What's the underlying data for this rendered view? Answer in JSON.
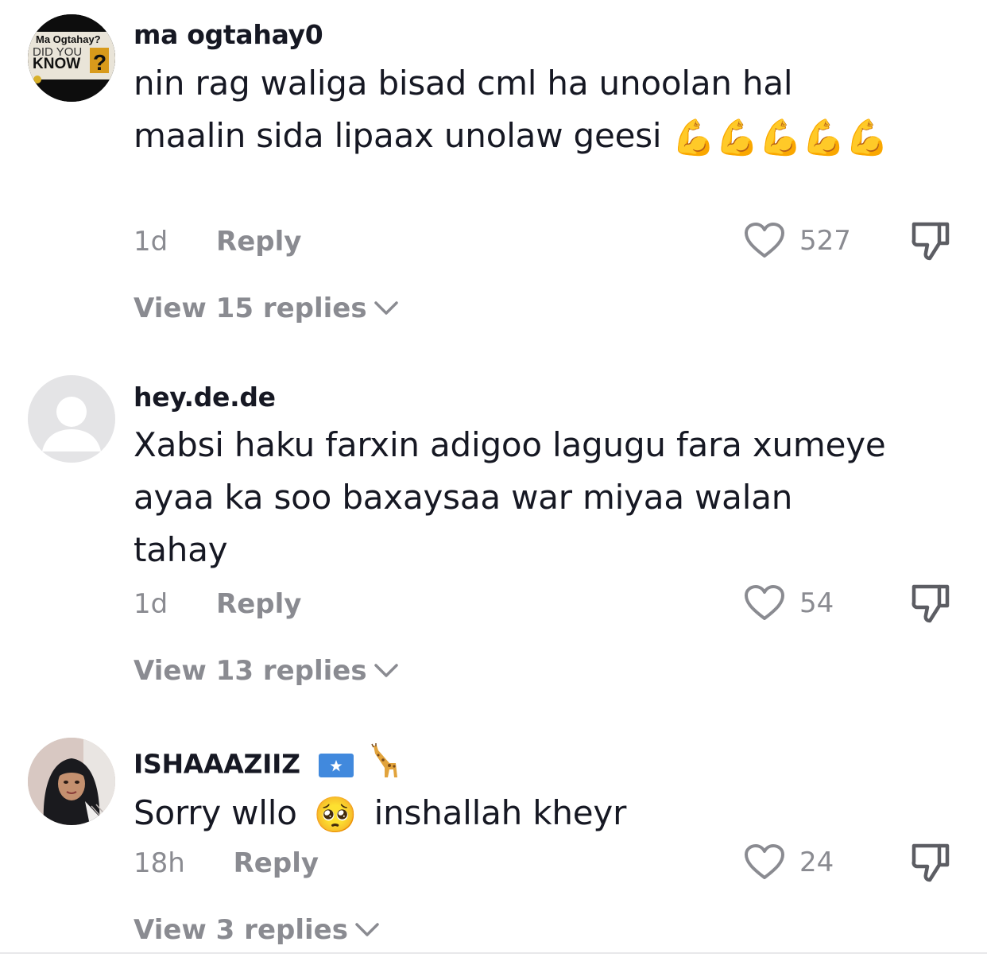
{
  "comments": [
    {
      "username": "ma ogtahay0",
      "text_a": "nin rag waliga bisad cml ha unoolan hal maalin sida lipaax unolaw geesi",
      "emojis": "💪💪💪💪💪",
      "time": "1d",
      "reply_label": "Reply",
      "likes": "527",
      "view_replies": "View 15 replies",
      "avatar": {
        "line1": "Ma Ogtahay?",
        "line2": "DID YOU",
        "line3": "KNOW",
        "mark": "?"
      }
    },
    {
      "username": "hey.de.de",
      "text_a": "Xabsi haku farxin adigoo lagugu fara xumeye ayaa ka soo baxaysaa war miyaa walan tahay",
      "time": "1d",
      "reply_label": "Reply",
      "likes": "54",
      "view_replies": "View 13 replies"
    },
    {
      "username": "ISHAAAZIIZ",
      "username_emojis": "🇸🇴 🦒",
      "text_a": "Sorry wllo",
      "text_emoji": "🥺",
      "text_b": "inshallah kheyr",
      "time": "18h",
      "reply_label": "Reply",
      "likes": "24",
      "view_replies": "View 3 replies"
    }
  ],
  "colors": {
    "primary_text": "#161823",
    "secondary_text": "#8a8b91",
    "flex_emoji": "#f5b21e",
    "somalia_blue": "#4189dd"
  },
  "icons": {
    "like": "heart-outline-icon",
    "dislike": "thumbs-down-icon",
    "expand": "chevron-down-icon",
    "default_avatar": "default-user-icon"
  }
}
